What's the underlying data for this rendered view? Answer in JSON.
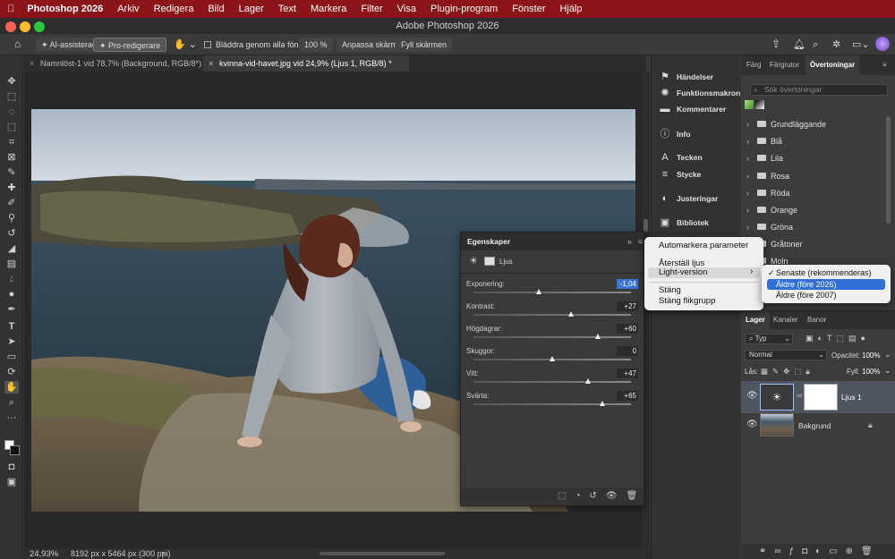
{
  "menubar": {
    "app": "Photoshop 2026",
    "items": [
      "Arkiv",
      "Redigera",
      "Bild",
      "Lager",
      "Text",
      "Markera",
      "Filter",
      "Visa",
      "Plugin-program",
      "Fönster",
      "Hjälp"
    ]
  },
  "window_title": "Adobe Photoshop 2026",
  "options_bar": {
    "ai_assist": "AI-assisterad",
    "pro_edit": "Pro-redigerare",
    "scroll_all": "Bläddra genom alla fönster",
    "zoom": "100 %",
    "fit_screen": "Anpassa skärm",
    "fill_screen": "Fyll skärmen"
  },
  "doc_tabs": [
    {
      "label": "Namnlöst-1 vid 78,7% (Background, RGB/8*) *"
    },
    {
      "label": "kvinna-vid-havet.jpg vid 24,9% (Ljus 1, RGB/8) *"
    }
  ],
  "status": {
    "zoom": "24,93%",
    "info": "8192 px x 5464 px (300 ppi)"
  },
  "dock": {
    "items": [
      "Händelser",
      "Funktionsmakron",
      "Kommentarer",
      "Info",
      "Tecken",
      "Stycke",
      "Justeringar",
      "Bibliotek"
    ],
    "icons": [
      "history-icon",
      "actions-icon",
      "comment-icon",
      "info-icon",
      "character-icon",
      "paragraph-icon",
      "adjustments-icon",
      "library-icon"
    ]
  },
  "gradients_panel": {
    "tabs": [
      "Färg",
      "Färgrutor",
      "Övertoningar"
    ],
    "search_placeholder": "Sök övertoningar",
    "groups": [
      "Grundläggande",
      "Blå",
      "Lila",
      "Rosa",
      "Röda",
      "Orange",
      "Gröna",
      "Gråtoner",
      "Moln"
    ]
  },
  "layers_panel": {
    "tabs": [
      "Lager",
      "Kanaler",
      "Banor"
    ],
    "filter": "Typ",
    "blend_mode": "Normal",
    "opacity_label": "Opacitet:",
    "opacity": "100%",
    "lock_label": "Lås:",
    "fill_label": "Fyll:",
    "fill": "100%",
    "layers": [
      {
        "name": "Ljus 1",
        "selected": true
      },
      {
        "name": "Bakgrund",
        "selected": false
      }
    ]
  },
  "properties": {
    "title": "Egenskaper",
    "subtitle": "Ljus",
    "sliders": [
      {
        "label": "Exponering:",
        "value": "-1,04",
        "pos": 0.42
      },
      {
        "label": "Kontrast:",
        "value": "+27",
        "pos": 0.62
      },
      {
        "label": "Högdagrar:",
        "value": "+60",
        "pos": 0.79
      },
      {
        "label": "Skuggor:",
        "value": "0",
        "pos": 0.5
      },
      {
        "label": "Vitt:",
        "value": "+47",
        "pos": 0.73
      },
      {
        "label": "Svärta:",
        "value": "+65",
        "pos": 0.82
      }
    ]
  },
  "context_menu": {
    "items": [
      "Automarkera parameter",
      "Återställ ljus",
      "Light-version",
      "Stäng",
      "Stäng flikgrupp"
    ]
  },
  "submenu": {
    "items": [
      "Senaste (rekommenderas)",
      "Äldre (före 2026)",
      "Äldre (före 2007)"
    ],
    "checkmark": "✓"
  },
  "colors": {
    "menubar": "#8b1418",
    "highlight": "#2f6fd6",
    "panel": "#3c3c3c"
  }
}
